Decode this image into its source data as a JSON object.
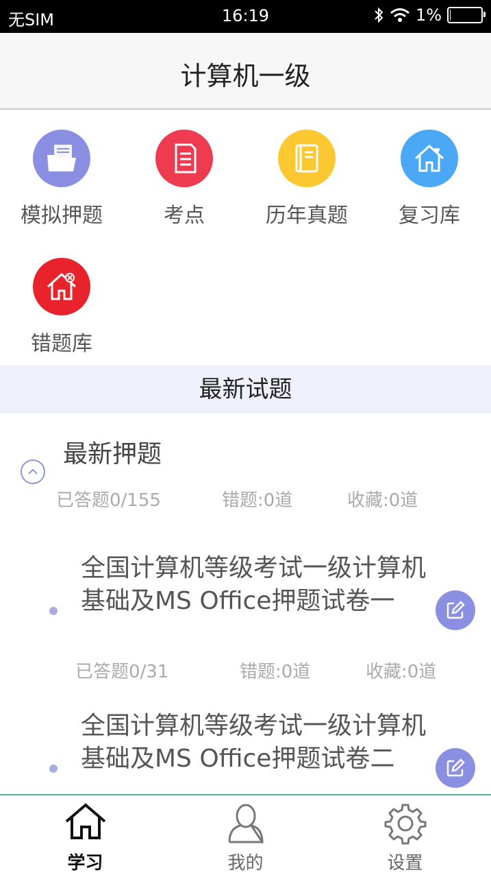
{
  "status_bar": {
    "carrier": "无SIM",
    "time": "16:19",
    "battery_percent": "1%",
    "battery_level": 0.01
  },
  "nav": {
    "title": "计算机一级"
  },
  "grid": [
    {
      "label": "模拟押题",
      "icon": "folder-icon",
      "color": "#8a8fe2"
    },
    {
      "label": "考点",
      "icon": "document-icon",
      "color": "#ee3b4f"
    },
    {
      "label": "历年真题",
      "icon": "book-icon",
      "color": "#fcc832"
    },
    {
      "label": "复习库",
      "icon": "home-heart-icon",
      "color": "#4aa8f7"
    },
    {
      "label": "错题库",
      "icon": "home-error-icon",
      "color": "#e8232c"
    }
  ],
  "section": {
    "title": "最新试题"
  },
  "group": {
    "title": "最新押题",
    "answered": "已答题0/155",
    "wrong": "错题:0道",
    "favorite": "收藏:0道"
  },
  "papers": [
    {
      "title": "全国计算机等级考试一级计算机基础及MS Office押题试卷一",
      "answered": "已答题0/31",
      "wrong": "错题:0道",
      "favorite": "收藏:0道"
    },
    {
      "title": "全国计算机等级考试一级计算机基础及MS Office押题试卷二",
      "answered": "",
      "wrong": "",
      "favorite": ""
    }
  ],
  "tabs": [
    {
      "label": "学习",
      "icon": "home-icon",
      "active": true
    },
    {
      "label": "我的",
      "icon": "person-icon",
      "active": false
    },
    {
      "label": "设置",
      "icon": "gear-icon",
      "active": false
    }
  ],
  "colors": {
    "accent": "#8a8fe2",
    "section_bg": "#eef0fb",
    "tab_border": "#5bb38a"
  }
}
